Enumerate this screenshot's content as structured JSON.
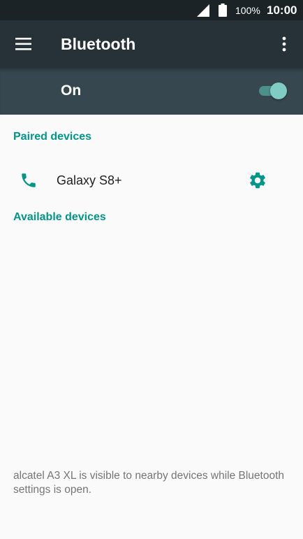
{
  "status_bar": {
    "battery_text": "100%",
    "time": "10:00",
    "icons": [
      "signal-icon",
      "battery-icon"
    ]
  },
  "app_bar": {
    "title": "Bluetooth",
    "icons": [
      "menu-icon",
      "more-vert-icon"
    ]
  },
  "switch_bar": {
    "state_label": "On",
    "toggle_on": true
  },
  "paired_section": {
    "header": "Paired devices",
    "devices": [
      {
        "name": "Galaxy S8+",
        "icon": "phone-icon",
        "action_icon": "gear-icon"
      }
    ]
  },
  "available_section": {
    "header": "Available devices"
  },
  "footer": {
    "text": "alcatel A3 XL is visible to nearby devices while Bluetooth settings is open."
  },
  "colors": {
    "status_bar_bg": "#1b2327",
    "app_bar_bg": "#263238",
    "switch_bar_bg": "#37474f",
    "accent": "#009688",
    "toggle_thumb": "#80cbc4",
    "background": "#fafafa"
  }
}
